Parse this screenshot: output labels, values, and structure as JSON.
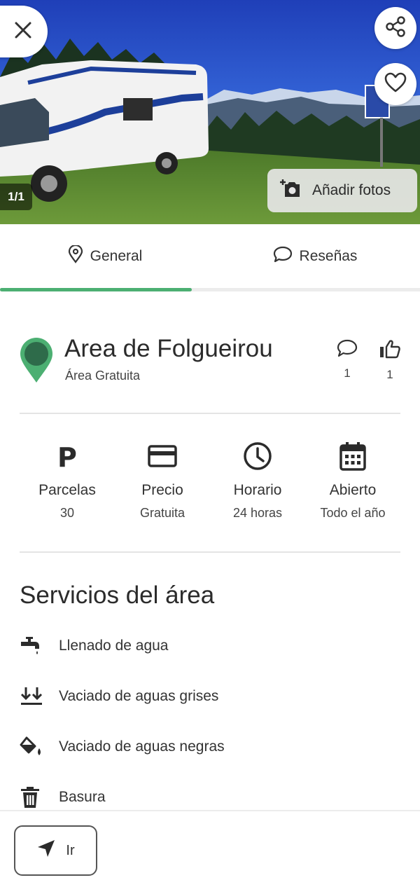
{
  "hero": {
    "photo_counter": "1/1",
    "add_photos_label": "Añadir fotos",
    "icons": {
      "close": "close-icon",
      "share": "share-icon",
      "favorite": "heart-icon",
      "add_photo": "add-photo-icon"
    }
  },
  "tabs": [
    {
      "label": "General",
      "icon": "location-pin-icon",
      "active": true
    },
    {
      "label": "Reseñas",
      "icon": "comment-icon",
      "active": false
    }
  ],
  "place": {
    "name": "Area de Folgueirou",
    "type": "Área Gratuita",
    "comments_count": "1",
    "likes_count": "1",
    "accent_color": "#4caf72",
    "pin_inner_color": "#2e6b4a"
  },
  "info": [
    {
      "icon": "parking-icon",
      "label": "Parcelas",
      "value": "30"
    },
    {
      "icon": "credit-card-icon",
      "label": "Precio",
      "value": "Gratuita"
    },
    {
      "icon": "clock-icon",
      "label": "Horario",
      "value": "24 horas"
    },
    {
      "icon": "calendar-icon",
      "label": "Abierto",
      "value": "Todo el año"
    }
  ],
  "services": {
    "title": "Servicios del área",
    "items": [
      {
        "icon": "water-tap-icon",
        "label": "Llenado de agua"
      },
      {
        "icon": "grey-water-drain-icon",
        "label": "Vaciado de aguas grises"
      },
      {
        "icon": "black-water-drain-icon",
        "label": "Vaciado de aguas negras"
      },
      {
        "icon": "trash-icon",
        "label": "Basura"
      }
    ]
  },
  "bottom": {
    "go_label": "Ir",
    "go_icon": "navigation-arrow-icon"
  }
}
